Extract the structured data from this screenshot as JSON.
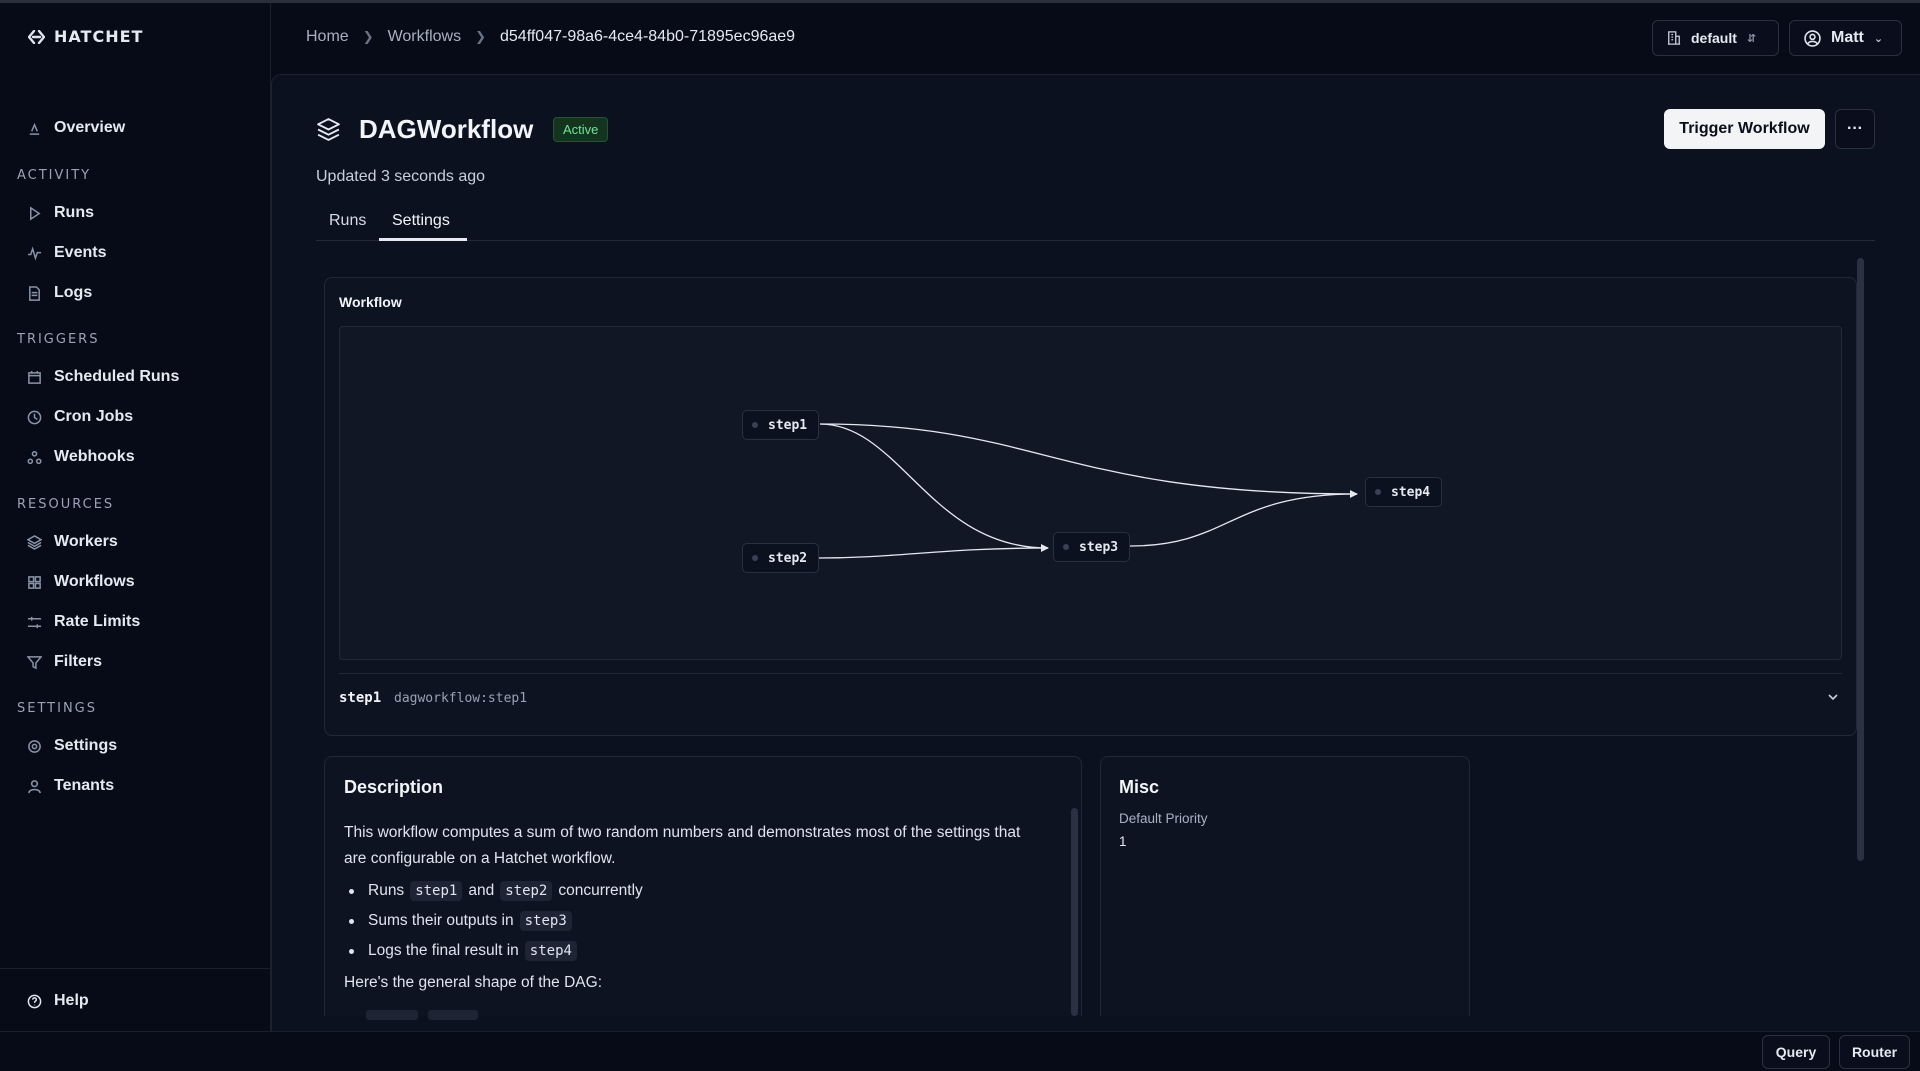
{
  "brand": {
    "name": "HATCHET"
  },
  "sidebar": {
    "overview": "Overview",
    "sections": {
      "activity": "ACTIVITY",
      "triggers": "TRIGGERS",
      "resources": "RESOURCES",
      "settings": "SETTINGS"
    },
    "items": {
      "runs": "Runs",
      "events": "Events",
      "logs": "Logs",
      "scheduled_runs": "Scheduled Runs",
      "cron_jobs": "Cron Jobs",
      "webhooks": "Webhooks",
      "workers": "Workers",
      "workflows": "Workflows",
      "rate_limits": "Rate Limits",
      "filters": "Filters",
      "settings": "Settings",
      "tenants": "Tenants"
    },
    "help": "Help"
  },
  "breadcrumb": {
    "home": "Home",
    "workflows": "Workflows",
    "current": "d54ff047-98a6-4ce4-84b0-71895ec96ae9"
  },
  "header": {
    "tenant": "default",
    "user": "Matt"
  },
  "workflow": {
    "name": "DAGWorkflow",
    "status": "Active",
    "updated": "Updated 3 seconds ago",
    "trigger_label": "Trigger Workflow",
    "more_label": "···"
  },
  "tabs": {
    "runs": "Runs",
    "settings": "Settings"
  },
  "workflow_card": {
    "title": "Workflow",
    "nodes": {
      "step1": "step1",
      "step2": "step2",
      "step3": "step3",
      "step4": "step4"
    },
    "edges": [
      [
        "step1",
        "step3"
      ],
      [
        "step2",
        "step3"
      ],
      [
        "step1",
        "step4"
      ],
      [
        "step3",
        "step4"
      ]
    ],
    "selected_step": {
      "name": "step1",
      "id": "dagworkflow:step1"
    }
  },
  "description": {
    "title": "Description",
    "intro": "This workflow computes a sum of two random numbers and demonstrates most of the settings that are configurable on a Hatchet workflow.",
    "bullet1": {
      "a": "Runs",
      "code1": "step1",
      "b": "and",
      "code2": "step2",
      "c": "concurrently"
    },
    "bullet2": {
      "a": "Sums their outputs in",
      "code": "step3"
    },
    "bullet3": {
      "a": "Logs the final result in",
      "code": "step4"
    },
    "shape": "Here's the general shape of the DAG:"
  },
  "misc": {
    "title": "Misc",
    "priority_label": "Default Priority",
    "priority_value": "1"
  },
  "footer": {
    "query": "Query",
    "router": "Router"
  }
}
